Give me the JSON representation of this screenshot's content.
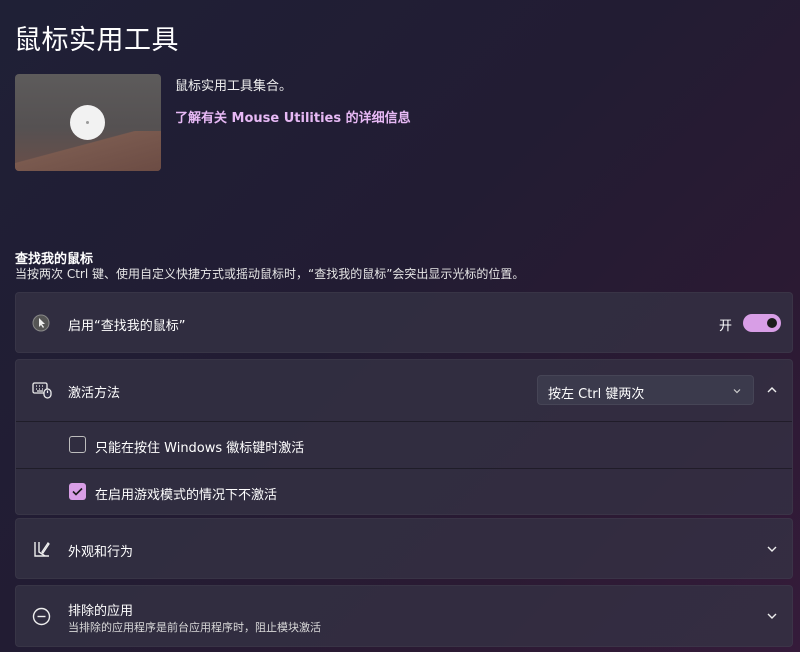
{
  "page": {
    "title": "鼠标实用工具",
    "description": "鼠标实用工具集合。",
    "learn_more": "了解有关 Mouse Utilities 的详细信息"
  },
  "find_my_mouse": {
    "title": "查找我的鼠标",
    "subtitle": "当按两次 Ctrl 键、使用自定义快捷方式或摇动鼠标时，“查找我的鼠标”会突出显示光标的位置。",
    "enable": {
      "label": "启用“查找我的鼠标”",
      "state_label": "开",
      "enabled": true
    },
    "activation": {
      "label": "激活方法",
      "selected": "按左 Ctrl 键两次",
      "expanded": true,
      "options": [
        {
          "label": "只能在按住 Windows 徽标键时激活",
          "checked": false
        },
        {
          "label": "在启用游戏模式的情况下不激活",
          "checked": true
        }
      ]
    },
    "appearance": {
      "label": "外观和行为"
    },
    "excluded_apps": {
      "label": "排除的应用",
      "description": "当排除的应用程序是前台应用程序时，阻止模块激活"
    }
  },
  "colors": {
    "accent": "#d89ee6",
    "link": "#e7b9f5"
  },
  "icons": [
    "mouse-cursor-icon",
    "keyboard-mouse-icon",
    "pen-ruler-icon",
    "block-icon",
    "chevron-down-icon",
    "chevron-up-icon",
    "checkmark-icon"
  ]
}
